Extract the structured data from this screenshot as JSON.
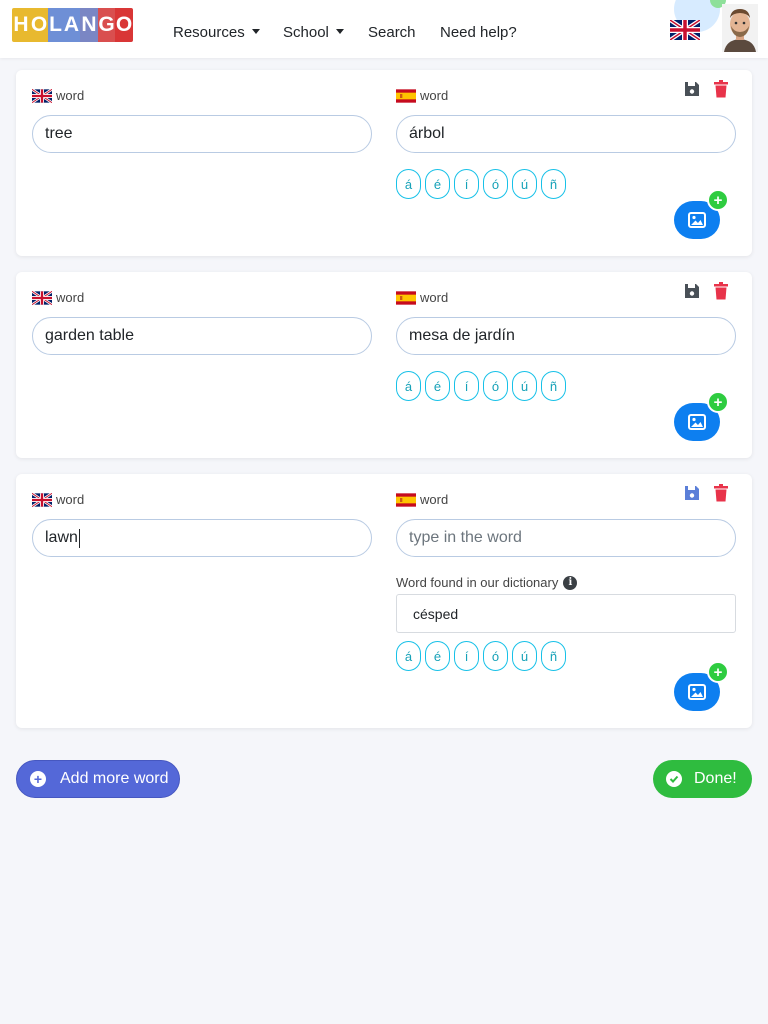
{
  "navbar": {
    "logo_letters": [
      "H",
      "O",
      "L",
      "A",
      "N",
      "G",
      "O"
    ],
    "logo_colors": [
      "#e8b92f",
      "#e8b92f",
      "#6e8fd6",
      "#6e8fd6",
      "#7a86c4",
      "#d94f4f",
      "#d93636"
    ],
    "links": {
      "resources": "Resources",
      "school": "School",
      "search": "Search",
      "help": "Need help?"
    },
    "language_flag_icon": "uk-flag-icon",
    "avatar_icon": "user-avatar"
  },
  "cards": [
    {
      "source": {
        "flag": "uk-flag-icon",
        "label": "word",
        "value": "tree"
      },
      "target": {
        "flag": "spain-flag-icon",
        "label": "word",
        "value": "árbol",
        "placeholder": "type in the word"
      },
      "accents": [
        "á",
        "é",
        "í",
        "ó",
        "ú",
        "ñ"
      ],
      "image_badge": "+"
    },
    {
      "source": {
        "flag": "uk-flag-icon",
        "label": "word",
        "value": "garden table"
      },
      "target": {
        "flag": "spain-flag-icon",
        "label": "word",
        "value": "mesa de jardín",
        "placeholder": "type in the word"
      },
      "accents": [
        "á",
        "é",
        "í",
        "ó",
        "ú",
        "ñ"
      ],
      "image_badge": "+"
    },
    {
      "source": {
        "flag": "uk-flag-icon",
        "label": "word",
        "value": "lawn"
      },
      "target": {
        "flag": "spain-flag-icon",
        "label": "word",
        "value": "",
        "placeholder": "type in the word"
      },
      "dictionary": {
        "label": "Word found in our dictionary",
        "info_icon": "i",
        "suggestion": "césped"
      },
      "accents": [
        "á",
        "é",
        "í",
        "ó",
        "ú",
        "ñ"
      ],
      "image_badge": "+"
    }
  ],
  "actions": {
    "add_more_icon": "+",
    "add_more": "Add more word",
    "done": "Done!"
  },
  "colors": {
    "primary": "#0d7ff0",
    "accent_outline": "#17c1e8",
    "danger": "#e8334a",
    "success": "#2fbc3f",
    "indigo": "#5468d8"
  }
}
